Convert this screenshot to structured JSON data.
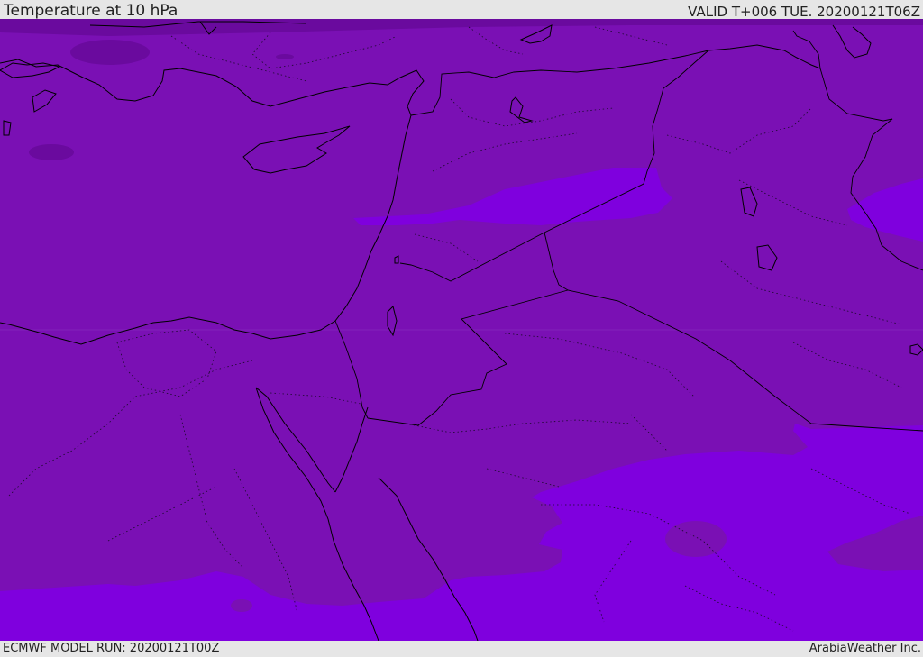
{
  "header": {
    "title": "Temperature at 10 hPa",
    "valid": "VALID T+006 TUE. 20200121T06Z"
  },
  "footer": {
    "model_run": "ECMWF MODEL RUN: 20200121T00Z",
    "credit": "ArabiaWeather Inc."
  },
  "colors": {
    "field_main": "#7a10b4",
    "field_warm": "#7f00de",
    "field_cold": "#62068f",
    "coastline": "#000000",
    "background": "#e6e6e6"
  }
}
